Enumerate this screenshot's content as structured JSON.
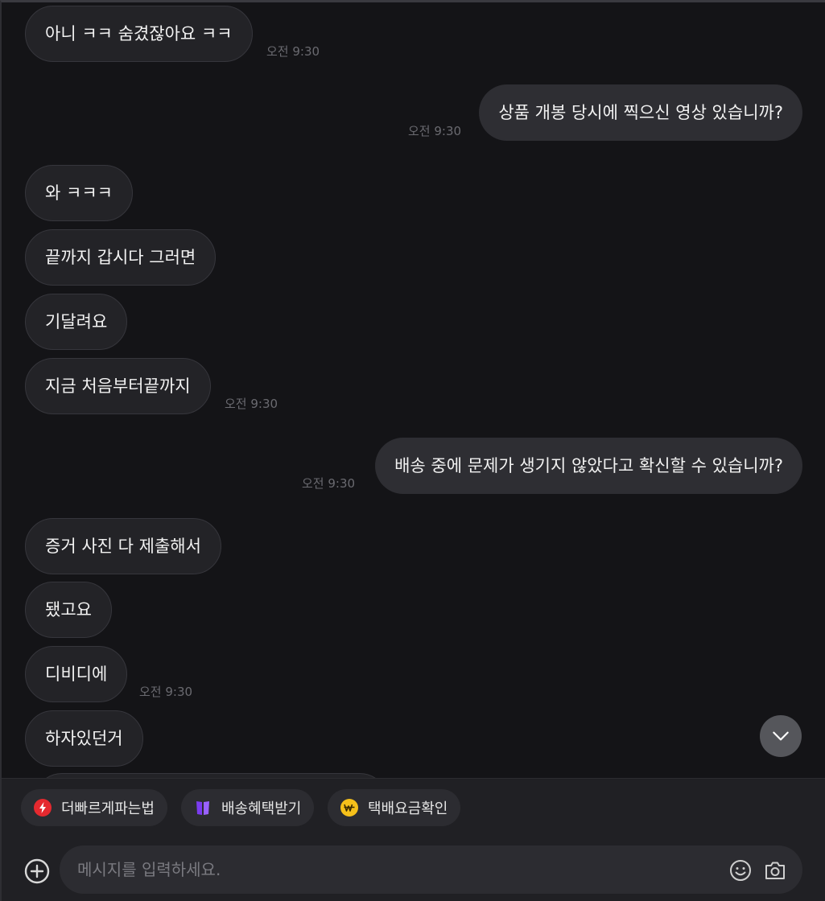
{
  "messages": [
    {
      "side": "left",
      "text": "아니 ㅋㅋ 숨겼잖아요 ㅋㅋ",
      "time": "오전 9:30"
    },
    {
      "side": "right",
      "text": "상품 개봉 당시에 찍으신 영상 있습니까?",
      "time": "오전 9:30"
    },
    {
      "side": "left",
      "text": "와 ㅋㅋㅋ",
      "time": ""
    },
    {
      "side": "left",
      "text": "끝까지 갑시다 그러면",
      "time": ""
    },
    {
      "side": "left",
      "text": "기달려요",
      "time": ""
    },
    {
      "side": "left",
      "text": "지금 처음부터끝까지",
      "time": "오전 9:30"
    },
    {
      "side": "right",
      "text": "배송 중에 문제가 생기지 않았다고 확신할 수 있습니까?",
      "time": "오전 9:30"
    },
    {
      "side": "left",
      "text": "증거 사진 다 제출해서",
      "time": ""
    },
    {
      "side": "left",
      "text": "됐고요",
      "time": ""
    },
    {
      "side": "left",
      "text": "디비디에",
      "time": "오전 9:30"
    },
    {
      "side": "left",
      "text": "하자있던거",
      "time": ""
    }
  ],
  "quick_actions": [
    {
      "label": "더빠르게파는법",
      "icon": "lightning-icon",
      "color": "#e5292f"
    },
    {
      "label": "배송혜택받기",
      "icon": "gift-box-icon",
      "color": "#7b3cf0"
    },
    {
      "label": "택배요금확인",
      "icon": "won-coin-icon",
      "color": "#f5c01a"
    }
  ],
  "input": {
    "placeholder": "메시지를 입력하세요."
  },
  "icons": {
    "add": "plus-circle-icon",
    "emoji": "smiley-icon",
    "camera": "camera-icon",
    "scroll": "chevron-down-icon"
  },
  "colors": {
    "background": "#141417",
    "bubble_incoming": "#232327",
    "bubble_outgoing": "#2e2e33",
    "timestamp": "#6a6a70"
  }
}
